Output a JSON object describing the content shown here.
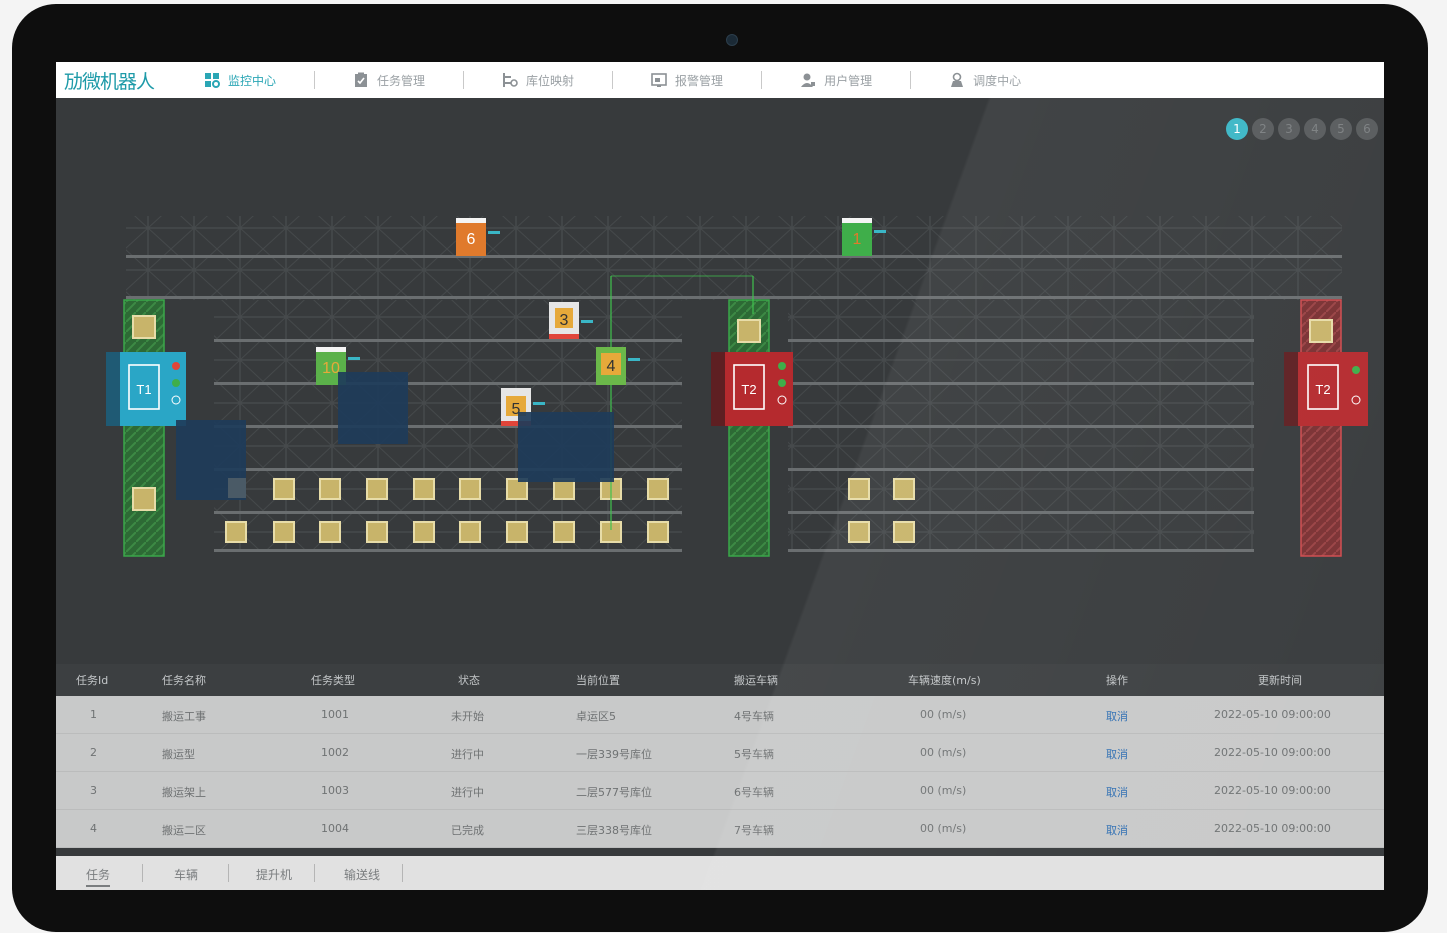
{
  "app": {
    "logo": "劢微机器人"
  },
  "nav": {
    "items": [
      {
        "label": "监控中心",
        "icon": "dashboard-icon",
        "active": true
      },
      {
        "label": "任务管理",
        "icon": "clipboard-check-icon",
        "active": false
      },
      {
        "label": "库位映射",
        "icon": "shelf-map-icon",
        "active": false
      },
      {
        "label": "报警管理",
        "icon": "alarm-monitor-icon",
        "active": false
      },
      {
        "label": "用户管理",
        "icon": "user-icon",
        "active": false
      },
      {
        "label": "调度中心",
        "icon": "dispatch-icon",
        "active": false
      }
    ]
  },
  "pager": {
    "pages": [
      "1",
      "2",
      "3",
      "4",
      "5",
      "6"
    ],
    "current": "1"
  },
  "map": {
    "lifts": [
      {
        "label": "T1",
        "color": "#2aa6c6"
      },
      {
        "label": "T2",
        "color": "#b52a2e"
      },
      {
        "label": "T2",
        "color": "#b52a2e"
      }
    ],
    "vehicles": [
      {
        "label": "6",
        "color": "#e07a2c"
      },
      {
        "label": "1",
        "color": "#3fae4a"
      },
      {
        "label": "3",
        "color": "#e6a93a"
      },
      {
        "label": "10",
        "color": "#5bb14a"
      },
      {
        "label": "4",
        "color": "#6bb84a"
      },
      {
        "label": "5",
        "color": "#e6a93a"
      }
    ]
  },
  "table": {
    "headers": [
      "任务Id",
      "任务名称",
      "任务类型",
      "状态",
      "当前位置",
      "搬运车辆",
      "车辆速度(m/s)",
      "操作",
      "更新时间"
    ],
    "rows": [
      [
        "1",
        "搬运工事",
        "1001",
        "未开始",
        "卓运区5",
        "4号车辆",
        "00 (m/s)",
        "取消",
        "2022-05-10 09:00:00"
      ],
      [
        "2",
        "搬运型",
        "1002",
        "进行中",
        "一层339号库位",
        "5号车辆",
        "00 (m/s)",
        "取消",
        "2022-05-10 09:00:00"
      ],
      [
        "3",
        "搬运架上",
        "1003",
        "进行中",
        "二层577号库位",
        "6号车辆",
        "00 (m/s)",
        "取消",
        "2022-05-10 09:00:00"
      ],
      [
        "4",
        "搬运二区",
        "1004",
        "已完成",
        "三层338号库位",
        "7号车辆",
        "00 (m/s)",
        "取消",
        "2022-05-10 09:00:00"
      ]
    ]
  },
  "tabs": [
    "任务",
    "车辆",
    "提升机",
    "输送线"
  ]
}
